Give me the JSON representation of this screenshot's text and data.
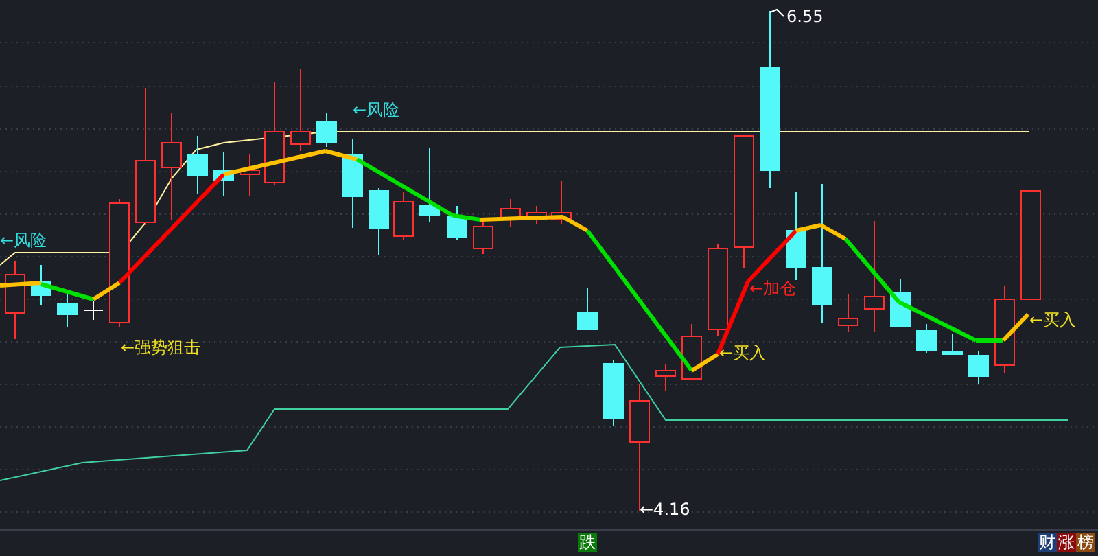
{
  "chart_labels": [
    {
      "text": "←风险",
      "kind": "risk"
    },
    {
      "text": "←风险",
      "kind": "risk"
    },
    {
      "text": "←强势狙击",
      "kind": "strong"
    },
    {
      "text": "←加仓",
      "kind": "add"
    },
    {
      "text": "←买入",
      "kind": "buy"
    },
    {
      "text": "←买入",
      "kind": "buy"
    }
  ],
  "price_markers": {
    "high": "6.55",
    "low": "←4.16"
  },
  "bottom_bar": {
    "left_badge": "跌",
    "right_badges": [
      {
        "text": "财",
        "color": "#1f3f7a"
      },
      {
        "text": "涨",
        "color": "#8b0a0a"
      },
      {
        "text": "榜",
        "color": "#8a4a12"
      }
    ]
  }
}
